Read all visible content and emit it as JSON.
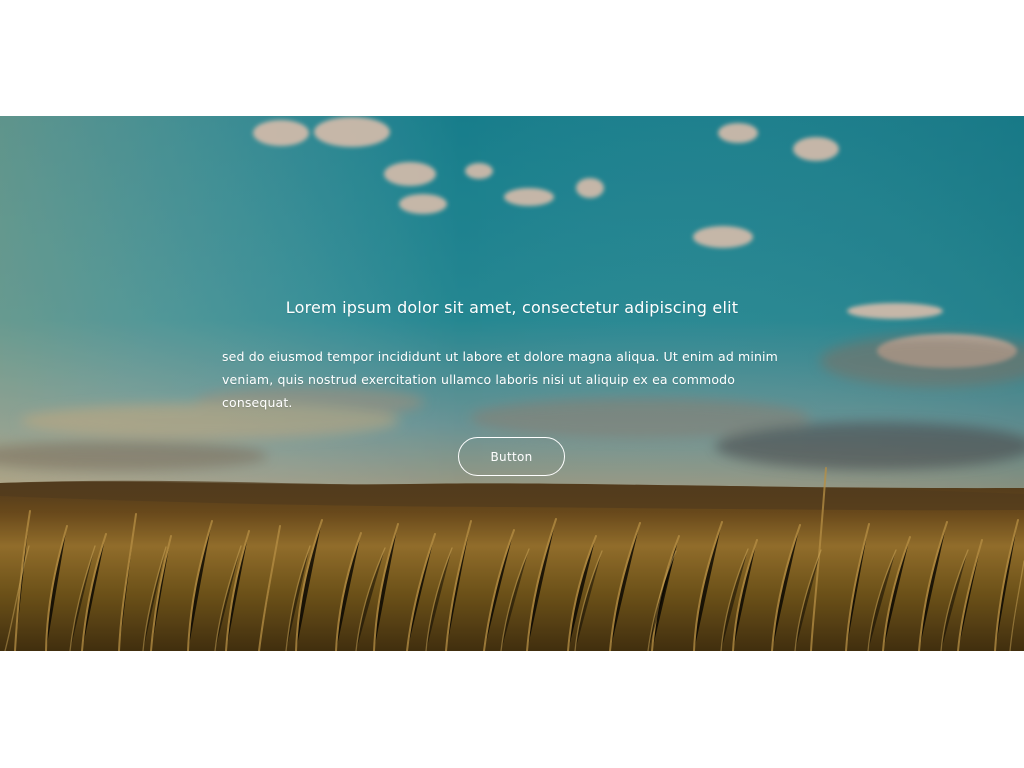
{
  "hero": {
    "title": "Lorem ipsum dolor sit amet, consectetur adipiscing elit",
    "body": "sed do eiusmod tempor incididunt ut labore et dolore magna aliqua. Ut enim ad minim veniam, quis nostrud exercitation ullamco laboris nisi ut aliquip ex ea commodo consequat.",
    "button_label": "Button"
  },
  "colors": {
    "page_background": "#ffffff",
    "sky_top": "#128c99",
    "horizon": "#d8b27c",
    "field": "#b78d2e",
    "text": "#ffffff"
  }
}
